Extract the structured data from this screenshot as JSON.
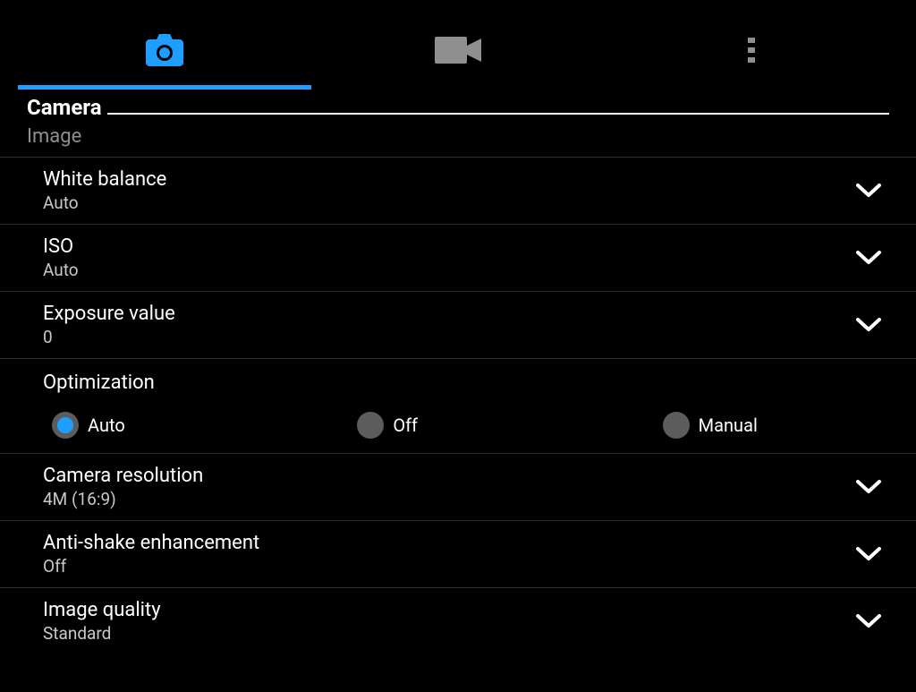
{
  "accent": "#1e9fff",
  "section_title": "Camera",
  "subsection_title": "Image",
  "settings": {
    "white_balance": {
      "label": "White balance",
      "value": "Auto"
    },
    "iso": {
      "label": "ISO",
      "value": "Auto"
    },
    "exposure": {
      "label": "Exposure value",
      "value": "0"
    },
    "optimization": {
      "label": "Optimization",
      "options": [
        "Auto",
        "Off",
        "Manual"
      ],
      "selected": "Auto"
    },
    "resolution": {
      "label": "Camera resolution",
      "value": "4M (16:9)"
    },
    "antishake": {
      "label": "Anti-shake enhancement",
      "value": "Off"
    },
    "quality": {
      "label": "Image quality",
      "value": "Standard"
    }
  }
}
